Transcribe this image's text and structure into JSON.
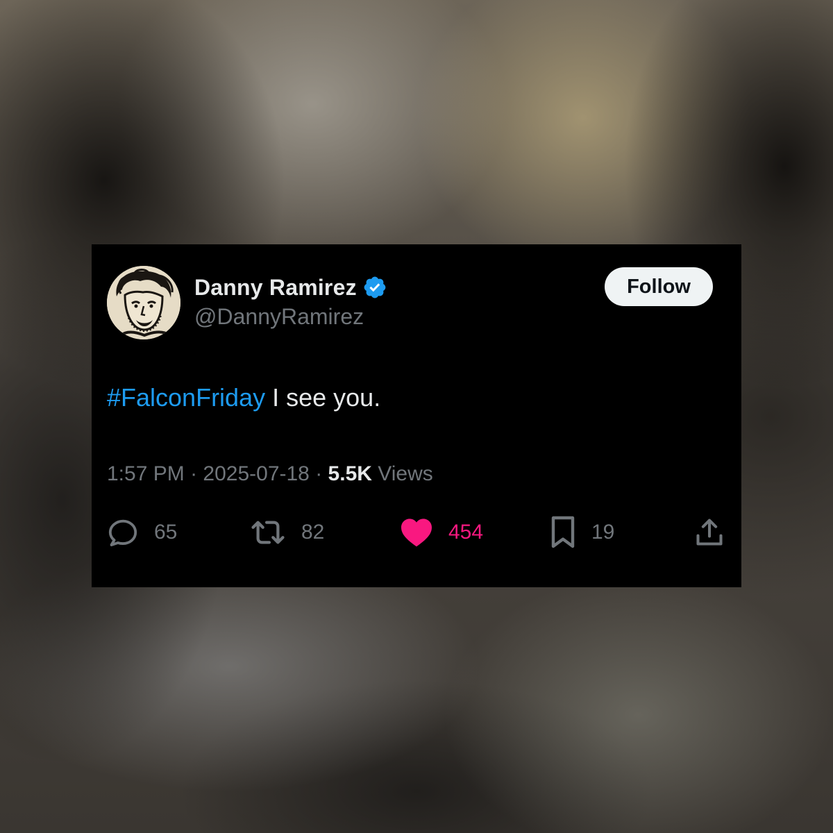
{
  "tweet": {
    "author": {
      "display_name": "Danny Ramirez",
      "handle": "@DannyRamirez",
      "verified": true,
      "verified_color": "#1d9bf0"
    },
    "follow_label": "Follow",
    "text": {
      "hashtag": "#FalconFriday",
      "body": " I see you."
    },
    "meta": {
      "time": "1:57 PM",
      "separator": " · ",
      "date": "2025-07-18",
      "views_count": "5.5K",
      "views_label": " Views"
    },
    "actions": {
      "replies": {
        "icon": "reply-icon",
        "count": "65"
      },
      "reposts": {
        "icon": "repost-icon",
        "count": "82"
      },
      "likes": {
        "icon": "heart-icon",
        "count": "454",
        "active": true,
        "color": "#f91880"
      },
      "bookmarks": {
        "icon": "bookmark-icon",
        "count": "19"
      },
      "share": {
        "icon": "share-icon"
      }
    }
  }
}
